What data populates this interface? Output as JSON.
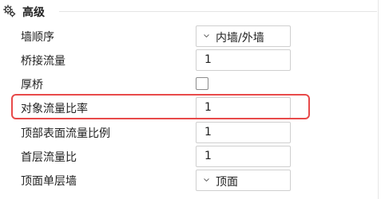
{
  "section": {
    "title": "高级",
    "icon": "gears-icon"
  },
  "rows": [
    {
      "label": "墙顺序",
      "type": "select",
      "value": "内墙/外墙"
    },
    {
      "label": "桥接流量",
      "type": "number",
      "value": "1"
    },
    {
      "label": "厚桥",
      "type": "checkbox",
      "checked": false
    },
    {
      "label": "对象流量比率",
      "type": "number",
      "value": "1",
      "highlighted": true
    },
    {
      "label": "顶部表面流量比例",
      "type": "number",
      "value": "1"
    },
    {
      "label": "首层流量比",
      "type": "number",
      "value": "1"
    },
    {
      "label": "顶面单层墙",
      "type": "select",
      "value": "顶面"
    }
  ],
  "colors": {
    "highlight": "#e84a4a",
    "field_border": "#cfcfcf"
  }
}
